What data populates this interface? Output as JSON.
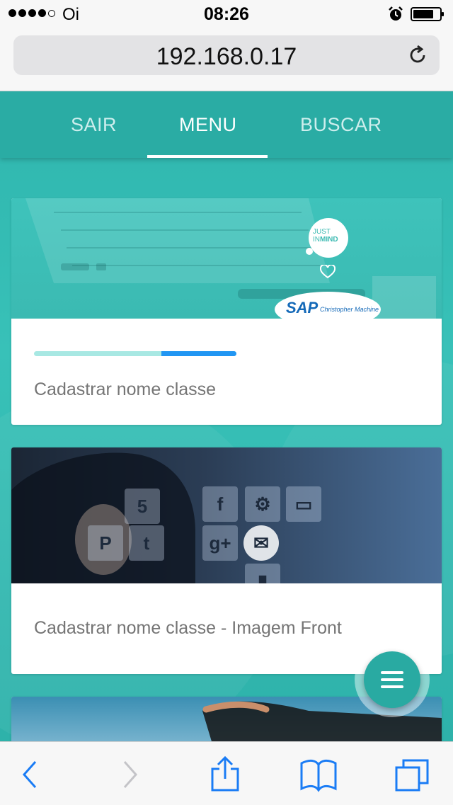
{
  "status_bar": {
    "carrier": "Oi",
    "time": "08:26",
    "signal_bars": 4,
    "signal_max": 5,
    "icons": [
      "alarm-icon",
      "battery-icon"
    ]
  },
  "browser": {
    "url": "192.168.0.17",
    "reload_icon": "reload-icon"
  },
  "tabs": [
    {
      "label": "SAIR",
      "active": false
    },
    {
      "label": "MENU",
      "active": true
    },
    {
      "label": "BUSCAR",
      "active": false
    }
  ],
  "cards": [
    {
      "title": "Cadastrar nome classe",
      "progress": 0.37,
      "image": {
        "logo_text_1": "JUST",
        "logo_text_2": "IN",
        "logo_text_3": "MIND",
        "sap_text": "SAP",
        "sap_sub": "Christopher Machine"
      }
    },
    {
      "title": "Cadastrar nome classe - Imagem Front",
      "image": {
        "tile_number": "5"
      }
    },
    {
      "title": ""
    }
  ],
  "fab": {
    "icon": "menu-icon"
  },
  "toolbar": {
    "icons": [
      "back-icon",
      "forward-icon",
      "share-icon",
      "bookmarks-icon",
      "tabs-icon"
    ]
  },
  "colors": {
    "primary": "#2aaca4",
    "accent": "#2196f3",
    "progress_track": "#a8e8e3",
    "ios_blue": "#1a7cf5"
  }
}
